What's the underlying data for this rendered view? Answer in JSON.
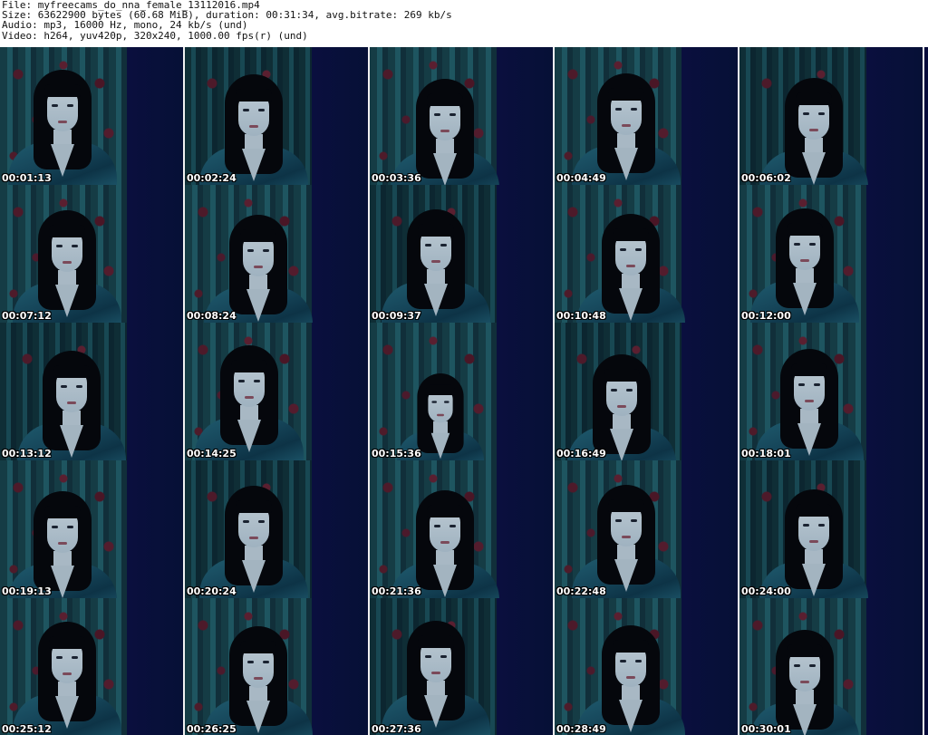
{
  "header": {
    "line1": "File: myfreecams_do_nna_female_13112016.mp4",
    "line2": "Size: 63622900 bytes (60.68 MiB), duration: 00:31:34, avg.bitrate: 269 kb/s",
    "line3": "Audio: mp3, 16000 Hz, mono, 24 kb/s (und)",
    "line4": "Video: h264, yuv420p, 320x240, 1000.00 fps(r) (und)"
  },
  "thumbnails": [
    {
      "time": "00:01:13"
    },
    {
      "time": "00:02:24"
    },
    {
      "time": "00:03:36"
    },
    {
      "time": "00:04:49"
    },
    {
      "time": "00:06:02"
    },
    {
      "time": "00:07:12"
    },
    {
      "time": "00:08:24"
    },
    {
      "time": "00:09:37"
    },
    {
      "time": "00:10:48"
    },
    {
      "time": "00:12:00"
    },
    {
      "time": "00:13:12"
    },
    {
      "time": "00:14:25"
    },
    {
      "time": "00:15:36"
    },
    {
      "time": "00:16:49"
    },
    {
      "time": "00:18:01"
    },
    {
      "time": "00:19:13"
    },
    {
      "time": "00:20:24"
    },
    {
      "time": "00:21:36"
    },
    {
      "time": "00:22:48"
    },
    {
      "time": "00:24:00"
    },
    {
      "time": "00:25:12"
    },
    {
      "time": "00:26:25"
    },
    {
      "time": "00:27:36"
    },
    {
      "time": "00:28:49"
    },
    {
      "time": "00:30:01"
    }
  ]
}
